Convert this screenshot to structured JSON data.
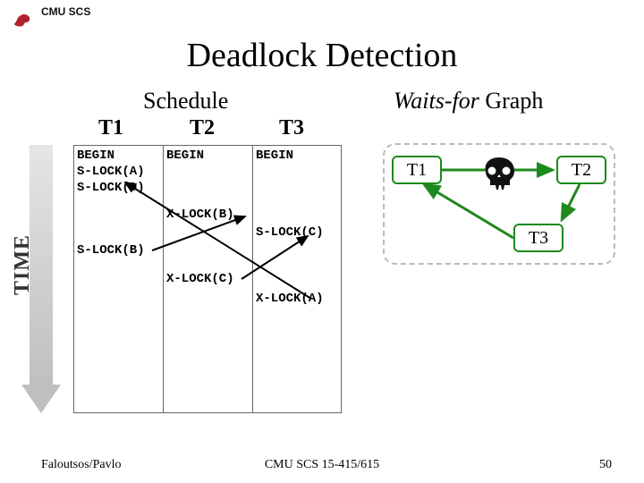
{
  "header": {
    "label": "CMU SCS"
  },
  "title": "Deadlock Detection",
  "schedule_label": "Schedule",
  "graph_label_italic": "Waits-for",
  "graph_label_rest": " Graph",
  "columns": {
    "t1": "T1",
    "t2": "T2",
    "t3": "T3"
  },
  "cells": {
    "t1_begin": "BEGIN",
    "t1_slock_a": "S-LOCK(A)",
    "t1_slock_d": "S-LOCK(D)",
    "t2_begin": "BEGIN",
    "t2_xlock_b": "X-LOCK(B)",
    "t3_begin": "BEGIN",
    "t3_slock_c": "S-LOCK(C)",
    "t1_slock_b": "S-LOCK(B)",
    "t2_xlock_c": "X-LOCK(C)",
    "t3_xlock_a": "X-LOCK(A)"
  },
  "time_label": "TIME",
  "nodes": {
    "n1": "T1",
    "n2": "T2",
    "n3": "T3"
  },
  "footer": {
    "left": "Faloutsos/Pavlo",
    "mid": "CMU SCS 15-415/615",
    "right": "50"
  },
  "colors": {
    "node_border": "#1d8a1d",
    "dash": "#bbbbbb"
  }
}
